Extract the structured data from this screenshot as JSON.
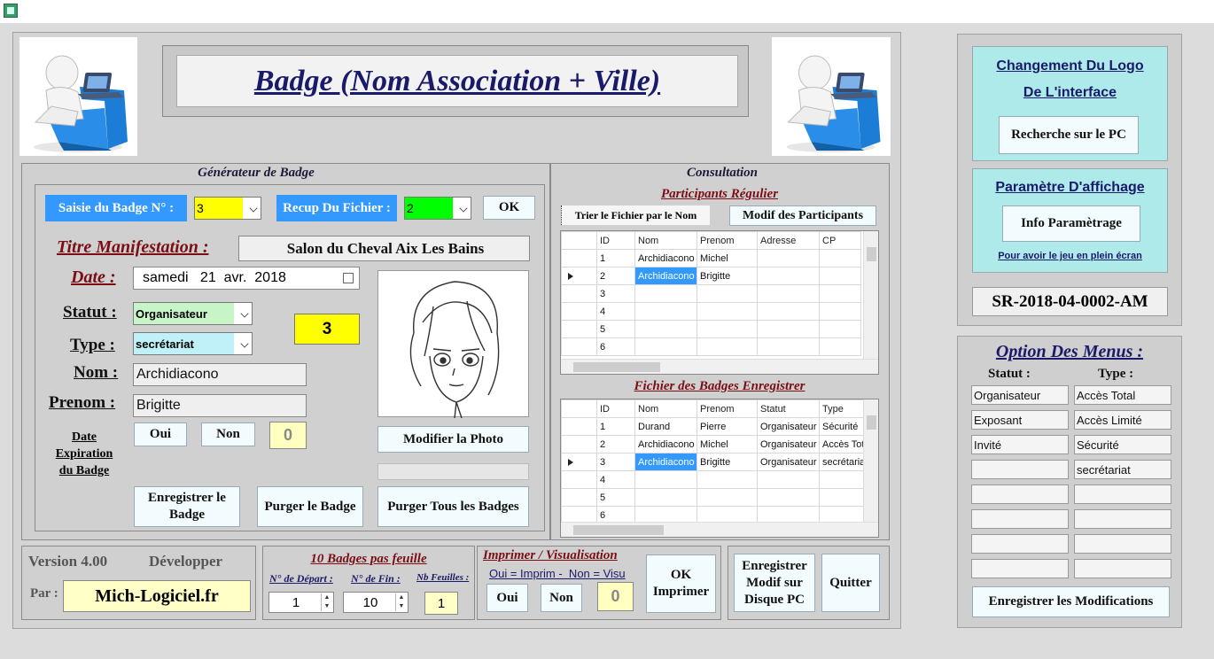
{
  "header": {
    "title": "Badge (Nom Association + Ville)"
  },
  "generator": {
    "section_title": "Générateur de Badge",
    "saisie_label": "Saisie du Badge N° :",
    "saisie_value": "3",
    "recup_label": "Recup Du Fichier :",
    "recup_value": "2",
    "ok_label": "OK",
    "titre_label": "Titre Manifestation :",
    "titre_value": "Salon du Cheval Aix Les Bains",
    "date_label": "Date :",
    "date_value": "samedi   21  avr.  2018",
    "statut_label": "Statut :",
    "statut_value": "Organisateur",
    "type_label": "Type :",
    "type_value": "secrétariat",
    "badge_number": "3",
    "nom_label": "Nom :",
    "nom_value": "Archidiacono",
    "prenom_label": "Prenom :",
    "prenom_value": "Brigitte",
    "expiration_label_1": "Date",
    "expiration_label_2": "Expiration",
    "expiration_label_3": "du Badge",
    "oui_label": "Oui",
    "non_label": "Non",
    "expiration_count": "0",
    "modifier_photo_label": "Modifier la Photo",
    "enregistrer_badge_label": "Enregistrer le Badge",
    "purger_badge_label": "Purger le Badge",
    "purger_tous_label": "Purger Tous les Badges"
  },
  "consultation": {
    "section_title": "Consultation",
    "participants_title": "Participants Régulier",
    "trier_label": "Trier le Fichier par le Nom",
    "modif_label": "Modif des Participants",
    "participants_columns": [
      "ID",
      "Nom",
      "Prenom",
      "Adresse",
      "CP"
    ],
    "participants_rows": [
      [
        "1",
        "Archidiacono",
        "Michel",
        "",
        ""
      ],
      [
        "2",
        "Archidiacono",
        "Brigitte",
        "",
        ""
      ],
      [
        "3",
        "",
        "",
        "",
        ""
      ],
      [
        "4",
        "",
        "",
        "",
        ""
      ],
      [
        "5",
        "",
        "",
        "",
        ""
      ],
      [
        "6",
        "",
        "",
        "",
        ""
      ]
    ],
    "badges_title": "Fichier des Badges Enregistrer",
    "badges_columns": [
      "ID",
      "Nom",
      "Prenom",
      "Statut",
      "Type"
    ],
    "badges_rows": [
      [
        "1",
        "Durand",
        "Pierre",
        "Organisateur",
        "Sécurité"
      ],
      [
        "2",
        "Archidiacono",
        "Michel",
        "Organisateur",
        "Accès Tot"
      ],
      [
        "3",
        "Archidiacono",
        "Brigitte",
        "Organisateur",
        "secrétariat"
      ],
      [
        "4",
        "",
        "",
        "",
        ""
      ],
      [
        "5",
        "",
        "",
        "",
        ""
      ],
      [
        "6",
        "",
        "",
        "",
        ""
      ]
    ]
  },
  "footer": {
    "version_label": "Version 4.00",
    "dev_label": "Développer",
    "par_label": "Par :",
    "author": "Mich-Logiciel.fr",
    "badges_feuille_title": "10 Badges pas feuille",
    "depart_label": "N° de Départ :",
    "depart_value": "1",
    "fin_label": "N° de Fin :",
    "fin_value": "10",
    "nb_feuilles_label": "Nb Feuilles :",
    "nb_feuilles_value": "1",
    "imprimer_title": "Imprimer / Visualisation",
    "imprimer_hint": "Oui = Imprim -  Non = Visu",
    "oui_label": "Oui",
    "non_label": "Non",
    "imprimer_count": "0",
    "ok_imprimer_label_1": "OK",
    "ok_imprimer_label_2": "Imprimer",
    "enregistrer_modif_1": "Enregistrer",
    "enregistrer_modif_2": "Modif sur",
    "enregistrer_modif_3": "Disque PC",
    "quitter_label": "Quitter"
  },
  "sidebar": {
    "logo_title_1": "Changement Du Logo",
    "logo_title_2": "De L'interface",
    "recherche_label": "Recherche sur le PC",
    "affichage_title": "Paramètre D'affichage",
    "info_label": "Info Paramètrage",
    "plein_ecran_link": "Pour avoir le jeu en plein écran",
    "serial": "SR-2018-04-0002-AM",
    "options_title": "Option Des Menus :",
    "statut_col": "Statut :",
    "type_col": "Type :",
    "statut_items": [
      "Organisateur",
      "Exposant",
      "Invité",
      "",
      "",
      "",
      "",
      ""
    ],
    "type_items": [
      "Accès Total",
      "Accès Limité",
      "Sécurité",
      "secrétariat",
      "",
      "",
      "",
      ""
    ],
    "enregistrer_modifs_label": "Enregistrer les Modifications"
  },
  "colors": {
    "badge_input_bg": "#ffff00",
    "recup_input_bg": "#00ff00",
    "blue_label_bg": "#3399ff",
    "statut_bg": "#c8f5c8",
    "type_bg": "#c0f0f8",
    "sidebar_cyan": "#aeeaea",
    "author_bg": "#ffffc8"
  }
}
